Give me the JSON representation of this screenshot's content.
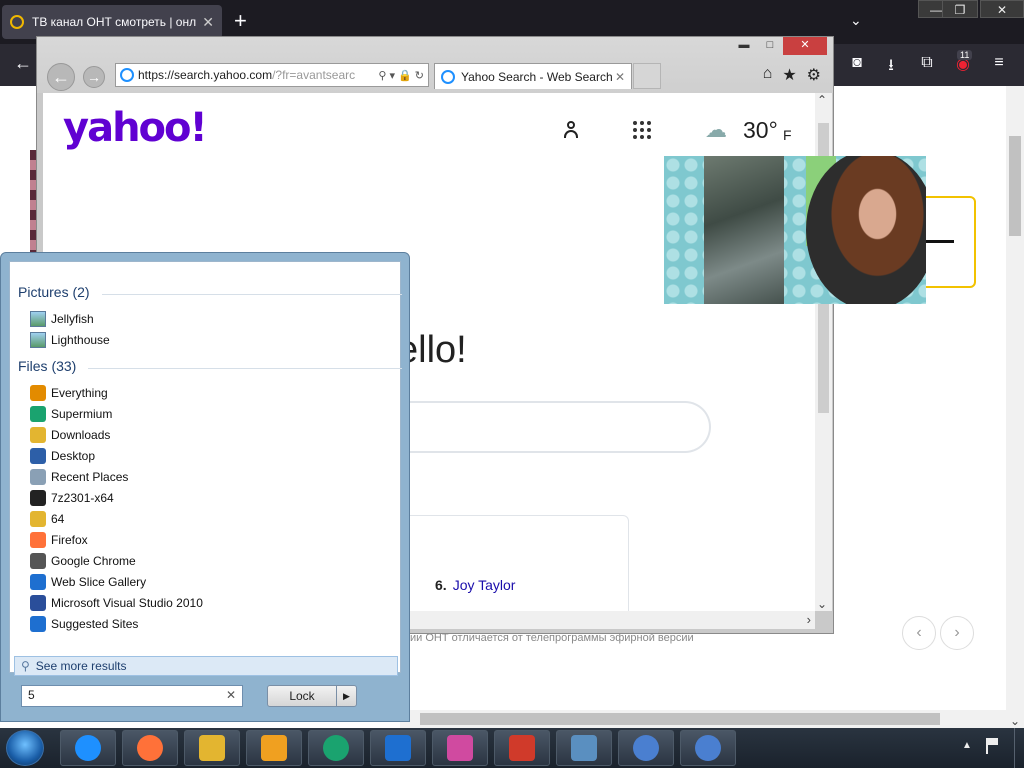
{
  "firefox": {
    "tab_title": "ТВ канал ОНТ смотреть | онл",
    "new_tab": "+",
    "list_tabs": "⌄",
    "window_controls": {
      "minimize": "—",
      "restore": "❐",
      "close": "✕"
    },
    "back": "←",
    "toolbar_icons": {
      "pocket": "◙",
      "downloads": "⭳",
      "extensions": "⧉",
      "addon": "◉",
      "menu": "≡"
    },
    "badge_count": "11",
    "caption_text": "ии ОНТ отличается от телепрограммы эфирной версии",
    "pager_prev": "‹",
    "pager_next": "›",
    "scroll_down": "⌄"
  },
  "ie": {
    "controls": {
      "minimize": "▬",
      "maximize": "□",
      "close": "✕"
    },
    "back": "←",
    "forward": "→",
    "url_main": "https://search.yahoo.com",
    "url_rest": "/?fr=avantsearc",
    "addr_icons": "⚲ ▾ 🔒 ↻",
    "tab_title": "Yahoo Search - Web Search",
    "tab_close": "✕",
    "toolbar_icons": {
      "home": "⌂",
      "favorites": "★",
      "tools": "⚙"
    },
    "scroll_up": "⌃",
    "scroll_down": "⌄",
    "scroll_right": "›"
  },
  "yahoo": {
    "logo": "yahoo!",
    "weather_icon": "☁",
    "temperature": "30°",
    "temperature_unit": "F",
    "greeting": "ello!",
    "trending_rank": "6.",
    "trending_name": "Joy Taylor"
  },
  "start_menu": {
    "pictures_header": "Pictures (2)",
    "pictures": [
      {
        "label": "Jellyfish",
        "icon": "picture-icon"
      },
      {
        "label": "Lighthouse",
        "icon": "picture-icon"
      }
    ],
    "files_header": "Files (33)",
    "files": [
      {
        "label": "Everything",
        "icon": "magnifier-icon",
        "color": "#e38b00"
      },
      {
        "label": "Supermium",
        "icon": "supermium-icon",
        "color": "#1aa36f"
      },
      {
        "label": "Downloads",
        "icon": "folder-download-icon",
        "color": "#e3b530"
      },
      {
        "label": "Desktop",
        "icon": "desktop-icon",
        "color": "#2d5fa8"
      },
      {
        "label": "Recent Places",
        "icon": "recent-places-icon",
        "color": "#8aa0b5"
      },
      {
        "label": "7z2301-x64",
        "icon": "7zip-icon",
        "color": "#222222"
      },
      {
        "label": "64",
        "icon": "folder-icon",
        "color": "#e3b530"
      },
      {
        "label": "Firefox",
        "icon": "firefox-icon",
        "color": "#ff7139"
      },
      {
        "label": "Google Chrome",
        "icon": "chrome-icon",
        "color": "#555555"
      },
      {
        "label": "Web Slice Gallery",
        "icon": "web-slice-icon",
        "color": "#1e6fd0"
      },
      {
        "label": "Microsoft Visual Studio 2010",
        "icon": "visual-studio-icon",
        "color": "#2a4e9a"
      },
      {
        "label": "Suggested Sites",
        "icon": "suggested-sites-icon",
        "color": "#1e6fd0"
      }
    ],
    "see_more": "See more results",
    "search_value": "5",
    "search_clear": "✕",
    "lock_label": "Lock",
    "lock_arrow": "▶"
  },
  "taskbar": {
    "apps": [
      {
        "name": "internet-explorer",
        "color": "#1e90ff"
      },
      {
        "name": "firefox",
        "color": "#ff7139"
      },
      {
        "name": "file-explorer",
        "color": "#e3b530"
      },
      {
        "name": "media-player",
        "color": "#f0a020"
      },
      {
        "name": "supermium",
        "color": "#1aa36f"
      },
      {
        "name": "avant-browser",
        "color": "#1e6fd0"
      },
      {
        "name": "cat-browser-pink",
        "color": "#d04aa0"
      },
      {
        "name": "cat-browser-red",
        "color": "#d03a2a"
      },
      {
        "name": "image-viewer",
        "color": "#5a8fc0"
      },
      {
        "name": "chrome-1",
        "color": "#4a7fd0"
      },
      {
        "name": "chrome-2",
        "color": "#4a7fd0"
      }
    ],
    "tray_arrow": "▲"
  }
}
